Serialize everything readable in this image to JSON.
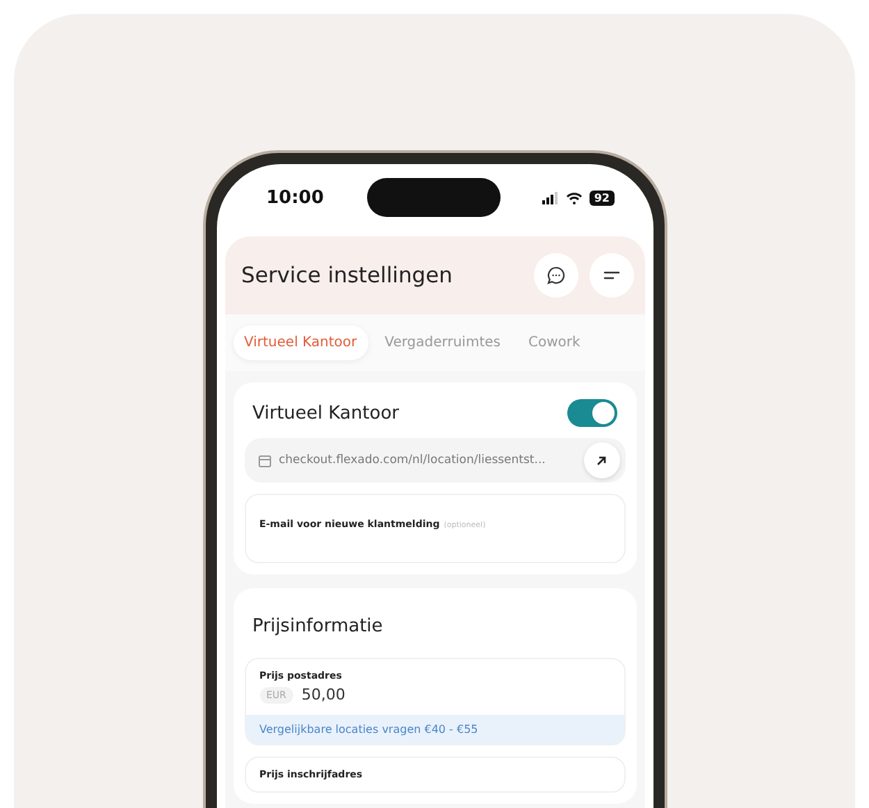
{
  "status_bar": {
    "time": "10:00",
    "battery": "92"
  },
  "header": {
    "title": "Service instellingen"
  },
  "tabs": [
    {
      "label": "Virtueel Kantoor",
      "selected": true
    },
    {
      "label": "Vergaderruimtes",
      "selected": false
    },
    {
      "label": "Cowork",
      "selected": false
    }
  ],
  "service_card": {
    "title": "Virtueel Kantoor",
    "on": true,
    "link": "checkout.flexado.com/nl/location/liessentst...",
    "email_label": "E-mail voor nieuwe klantmelding",
    "email_hint": "(optioneel)"
  },
  "price_card": {
    "title": "Prijsinformatie",
    "fields": [
      {
        "label": "Prijs postadres",
        "currency": "EUR",
        "value": "50,00",
        "note": "Vergelijkbare locaties vragen €40 - €55"
      },
      {
        "label": "Prijs inschrijfadres"
      }
    ]
  }
}
